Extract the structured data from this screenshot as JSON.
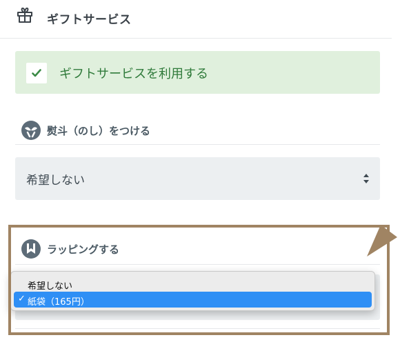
{
  "header": {
    "title": "ギフトサービス",
    "icon": "gift-icon"
  },
  "gift_service": {
    "label": "ギフトサービスを利用する",
    "checked": true,
    "accent": "#2f7a3a"
  },
  "noshi": {
    "heading": "熨斗（のし）をつける",
    "icon": "noshi-icon",
    "select_value": "希望しない"
  },
  "wrapping": {
    "heading": "ラッピングする",
    "icon": "wrapping-icon",
    "options": [
      {
        "label": "希望しない",
        "selected": false
      },
      {
        "label": "紙袋（165円）",
        "selected": true
      }
    ],
    "selected_check": "✓"
  },
  "colors": {
    "frame": "#a08463",
    "selection": "#2f8ff5",
    "success_bg": "#e0f0dd"
  }
}
